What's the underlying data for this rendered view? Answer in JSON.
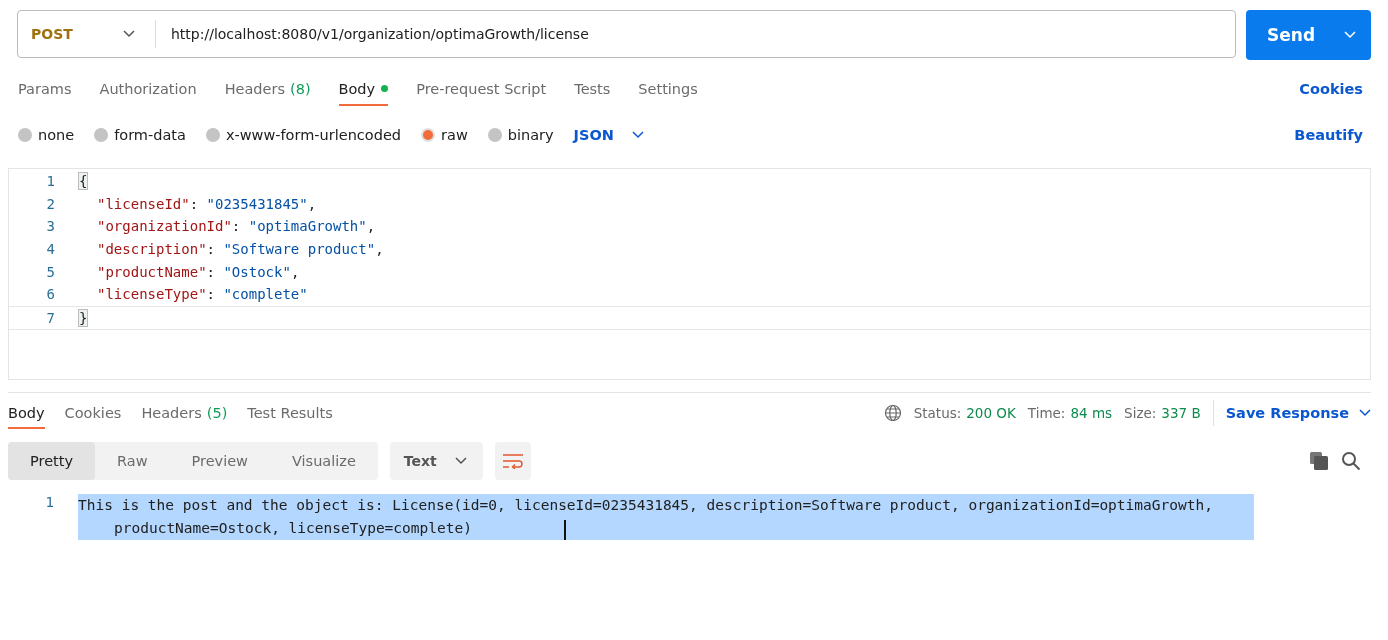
{
  "request": {
    "method": "POST",
    "url": "http://localhost:8080/v1/organization/optimaGrowth/license",
    "send_label": "Send"
  },
  "request_tabs": [
    {
      "label": "Params",
      "modified": false,
      "selected": false
    },
    {
      "label": "Authorization",
      "modified": false,
      "selected": false
    },
    {
      "label": "Headers",
      "count": "(8)",
      "modified": false,
      "selected": false
    },
    {
      "label": "Body",
      "modified": true,
      "selected": true
    },
    {
      "label": "Pre-request Script",
      "modified": false,
      "selected": false
    },
    {
      "label": "Tests",
      "modified": false,
      "selected": false
    },
    {
      "label": "Settings",
      "modified": false,
      "selected": false
    }
  ],
  "cookies_link": "Cookies",
  "body_types": [
    {
      "label": "none",
      "selected": false
    },
    {
      "label": "form-data",
      "selected": false
    },
    {
      "label": "x-www-form-urlencoded",
      "selected": false
    },
    {
      "label": "raw",
      "selected": true
    },
    {
      "label": "binary",
      "selected": false
    }
  ],
  "body_format": "JSON",
  "beautify_link": "Beautify",
  "editor_lines": [
    {
      "number": "1",
      "kind": "brace",
      "tokens": [
        {
          "kind": "punct",
          "text": "{"
        }
      ]
    },
    {
      "number": "2",
      "kind": "member",
      "tokens": [
        {
          "kind": "key",
          "text": "\"licenseId\""
        },
        {
          "kind": "punct",
          "text": ": "
        },
        {
          "kind": "string",
          "text": "\"0235431845\""
        },
        {
          "kind": "punct",
          "text": ","
        }
      ]
    },
    {
      "number": "3",
      "kind": "member",
      "tokens": [
        {
          "kind": "key",
          "text": "\"organizationId\""
        },
        {
          "kind": "punct",
          "text": ": "
        },
        {
          "kind": "string",
          "text": "\"optimaGrowth\""
        },
        {
          "kind": "punct",
          "text": ","
        }
      ]
    },
    {
      "number": "4",
      "kind": "member",
      "tokens": [
        {
          "kind": "key",
          "text": "\"description\""
        },
        {
          "kind": "punct",
          "text": ": "
        },
        {
          "kind": "string",
          "text": "\"Software product\""
        },
        {
          "kind": "punct",
          "text": ","
        }
      ]
    },
    {
      "number": "5",
      "kind": "member",
      "tokens": [
        {
          "kind": "key",
          "text": "\"productName\""
        },
        {
          "kind": "punct",
          "text": ": "
        },
        {
          "kind": "string",
          "text": "\"Ostock\""
        },
        {
          "kind": "punct",
          "text": ","
        }
      ]
    },
    {
      "number": "6",
      "kind": "member",
      "tokens": [
        {
          "kind": "key",
          "text": "\"licenseType\""
        },
        {
          "kind": "punct",
          "text": ": "
        },
        {
          "kind": "string",
          "text": "\"complete\""
        }
      ]
    },
    {
      "number": "7",
      "kind": "brace",
      "tokens": [
        {
          "kind": "punct",
          "text": "}"
        }
      ]
    }
  ],
  "response_tabs": [
    {
      "label": "Body",
      "selected": true
    },
    {
      "label": "Cookies",
      "selected": false
    },
    {
      "label": "Headers",
      "count": "(5)",
      "selected": false
    },
    {
      "label": "Test Results",
      "selected": false
    }
  ],
  "response_meta": [
    {
      "label": "Status:",
      "value": "200 OK"
    },
    {
      "label": "Time:",
      "value": "84 ms"
    },
    {
      "label": "Size:",
      "value": "337 B"
    }
  ],
  "save_response": "Save Response",
  "view_modes": [
    {
      "label": "Pretty",
      "selected": true
    },
    {
      "label": "Raw",
      "selected": false
    },
    {
      "label": "Preview",
      "selected": false
    },
    {
      "label": "Visualize",
      "selected": false
    }
  ],
  "response_format": "Text",
  "response_lines": [
    {
      "number": "1",
      "text": "This is the post and the object is: License(id=0, licenseId=0235431845, description=Software product, organizationId=optimaGrowth, productName=Ostock, licenseType=complete)",
      "selected": true
    }
  ]
}
